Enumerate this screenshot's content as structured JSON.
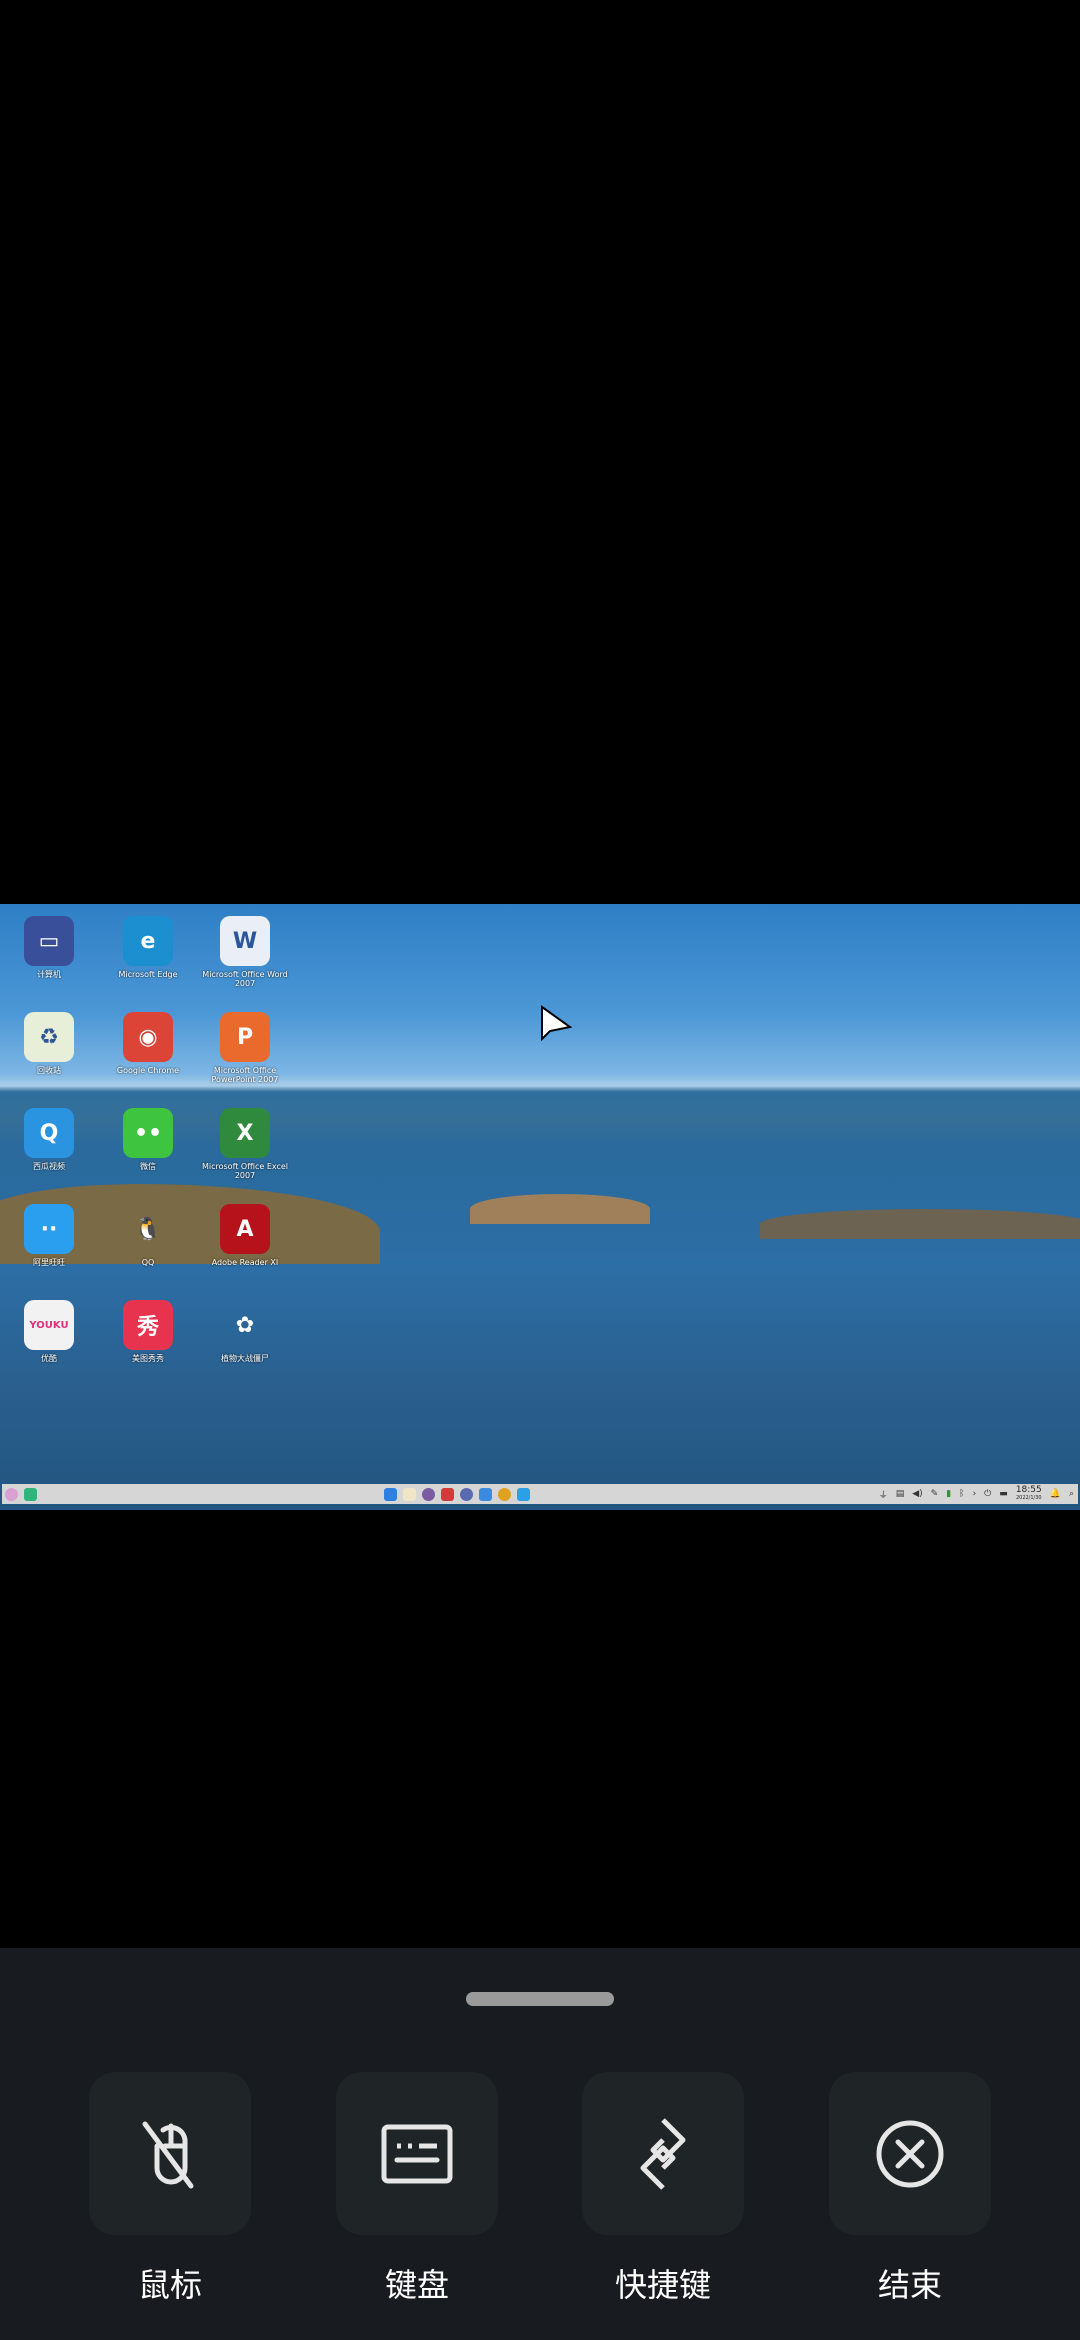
{
  "desktop": {
    "icons": [
      {
        "label": "计算机",
        "glyph": "▭",
        "color": "#3a4f9a"
      },
      {
        "label": "Microsoft Edge",
        "glyph": "e",
        "color": "#1c8fd0"
      },
      {
        "label": "Microsoft Office Word 2007",
        "glyph": "W",
        "color": "#e9eef7"
      },
      {
        "label": "回收站",
        "glyph": "♻",
        "color": "#e8efd8"
      },
      {
        "label": "Google Chrome",
        "glyph": "◉",
        "color": "#db4437"
      },
      {
        "label": "Microsoft Office PowerPoint 2007",
        "glyph": "P",
        "color": "#e96a2c"
      },
      {
        "label": "西瓜视频",
        "glyph": "Q",
        "color": "#2a94e0"
      },
      {
        "label": "微信",
        "glyph": "••",
        "color": "#3fc43f"
      },
      {
        "label": "Microsoft Office Excel 2007",
        "glyph": "X",
        "color": "#2f8a3d"
      },
      {
        "label": "阿里旺旺",
        "glyph": "··",
        "color": "#2a9ff0"
      },
      {
        "label": "QQ",
        "glyph": "🐧",
        "color": "transparent"
      },
      {
        "label": "Adobe Reader XI",
        "glyph": "A",
        "color": "#b5121b"
      },
      {
        "label": "优酷",
        "glyph": "YOUKU",
        "color": "#f2f2f2"
      },
      {
        "label": "美图秀秀",
        "glyph": "秀",
        "color": "#e8334f"
      },
      {
        "label": "植物大战僵尸",
        "glyph": "✿",
        "color": "transparent"
      }
    ],
    "taskbar": {
      "time": "18:55",
      "date": "2022/1/30"
    }
  },
  "controls": {
    "buttons": [
      {
        "label": "鼠标",
        "icon": "mouse-off-icon"
      },
      {
        "label": "键盘",
        "icon": "keyboard-icon"
      },
      {
        "label": "快捷键",
        "icon": "shortcut-icon"
      },
      {
        "label": "结束",
        "icon": "close-circle-icon"
      }
    ]
  }
}
